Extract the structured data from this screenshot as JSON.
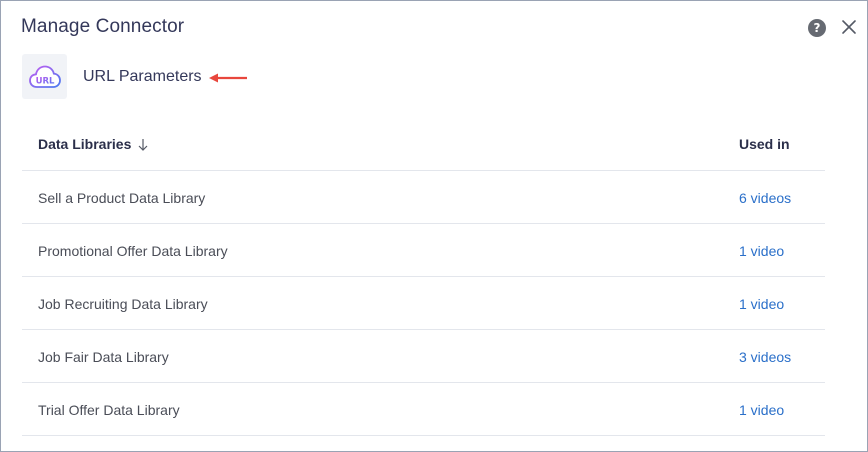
{
  "dialog": {
    "title": "Manage Connector",
    "help_icon": "question-circle-icon",
    "close_icon": "close-icon"
  },
  "connector": {
    "name": "URL Parameters",
    "logo_text": "URL",
    "logo_icon": "url-cloud-icon",
    "annotation_icon": "red-arrow-left-icon",
    "annotation_color": "#e8473d"
  },
  "table": {
    "columns": [
      "Data Libraries",
      "Used in"
    ],
    "sort_icon": "arrow-down-icon",
    "rows": [
      {
        "name": "Sell a Product Data Library",
        "used_in": "6 videos"
      },
      {
        "name": "Promotional Offer Data Library",
        "used_in": "1 video"
      },
      {
        "name": "Job Recruiting Data Library",
        "used_in": "1 video"
      },
      {
        "name": "Job Fair Data Library",
        "used_in": "3 videos"
      },
      {
        "name": "Trial Offer Data Library",
        "used_in": "1 video"
      }
    ]
  },
  "colors": {
    "link": "#2a6fc9",
    "logo_gradient_start": "#8b5cf6",
    "logo_gradient_end": "#3b82f6"
  }
}
